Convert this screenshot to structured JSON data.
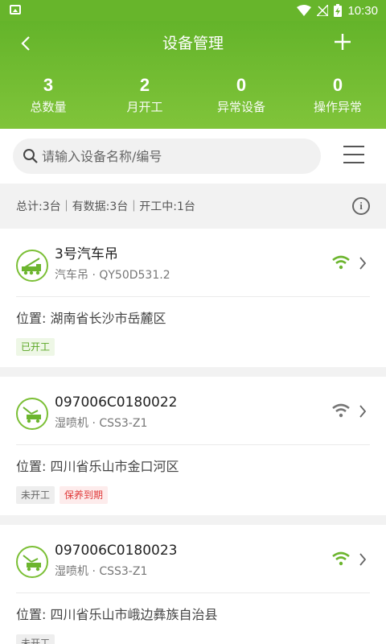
{
  "status_bar": {
    "time": "10:30"
  },
  "header": {
    "title": "设备管理",
    "stats": [
      {
        "value": "3",
        "label": "总数量"
      },
      {
        "value": "2",
        "label": "月开工"
      },
      {
        "value": "0",
        "label": "异常设备"
      },
      {
        "value": "0",
        "label": "操作异常"
      }
    ]
  },
  "search": {
    "placeholder": "请输入设备名称/编号"
  },
  "summary": {
    "text": "总计:3台｜有数据:3台｜开工中:1台"
  },
  "devices": [
    {
      "name": "3号汽车吊",
      "model": "汽车吊 · QY50D531.2",
      "location": "位置: 湖南省长沙市岳麓区",
      "signal_color": "#6cb52e",
      "tags": [
        "已开工"
      ]
    },
    {
      "name": "097006C0180022",
      "model": "湿喷机 · CSS3-Z1",
      "location": "位置: 四川省乐山市金口河区",
      "signal_color": "#777777",
      "tags": [
        "未开工",
        "保养到期"
      ]
    },
    {
      "name": "097006C0180023",
      "model": "湿喷机 · CSS3-Z1",
      "location": "位置: 四川省乐山市峨边彝族自治县",
      "signal_color": "#6cb52e",
      "tags": [
        "未开工"
      ]
    }
  ],
  "colors": {
    "brand": "#67b52b",
    "working": "#5aa623",
    "alert": "#e03a3a"
  }
}
